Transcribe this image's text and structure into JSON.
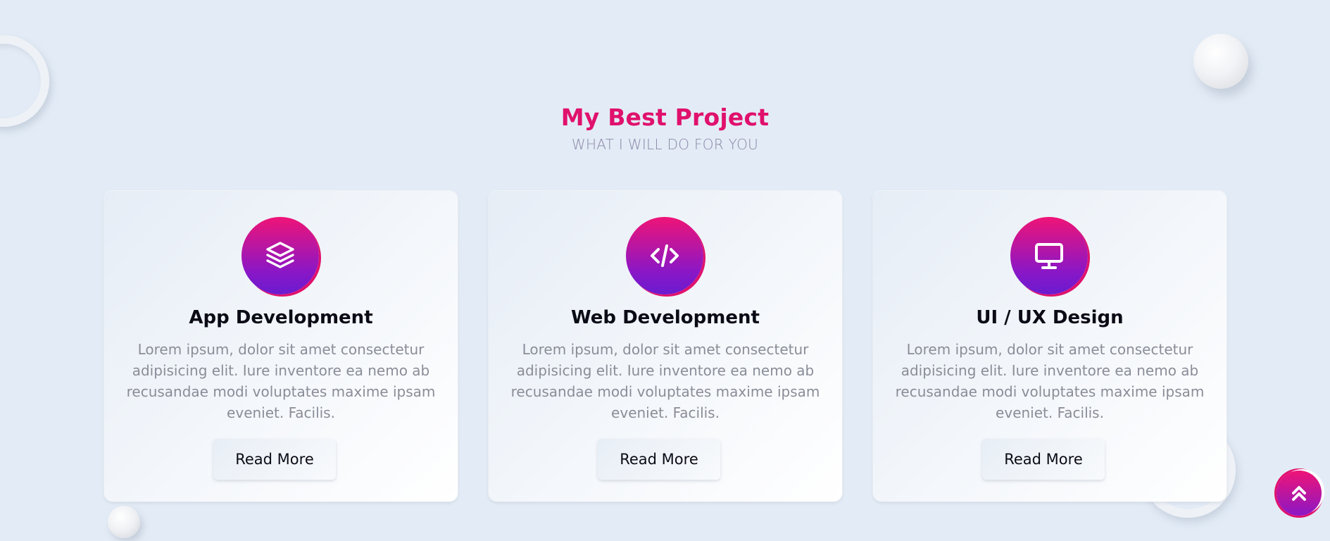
{
  "section": {
    "title": "My Best Project",
    "subtitle": "WHAT I WILL DO FOR YOU"
  },
  "cards": [
    {
      "icon": "layers-icon",
      "title": "App Development",
      "text": "Lorem ipsum, dolor sit amet consectetur adipisicing elit. Iure inventore ea nemo ab recusandae modi voluptates maxime ipsam eveniet. Facilis.",
      "button_label": "Read More"
    },
    {
      "icon": "code-icon",
      "title": "Web Development",
      "text": "Lorem ipsum, dolor sit amet consectetur adipisicing elit. Iure inventore ea nemo ab recusandae modi voluptates maxime ipsam eveniet. Facilis.",
      "button_label": "Read More"
    },
    {
      "icon": "desktop-icon",
      "title": "UI / UX Design",
      "text": "Lorem ipsum, dolor sit amet consectetur adipisicing elit. Iure inventore ea nemo ab recusandae modi voluptates maxime ipsam eveniet. Facilis.",
      "button_label": "Read More"
    }
  ],
  "scroll_top": {
    "icon": "double-chevron-up-icon"
  },
  "colors": {
    "background": "#e3ecf6",
    "accent": "#e0116d",
    "icon_gradient_start": "#ef1476",
    "icon_gradient_end": "#6a1bd0",
    "subtitle": "#8a86a6",
    "body_text": "#8a8d97"
  }
}
